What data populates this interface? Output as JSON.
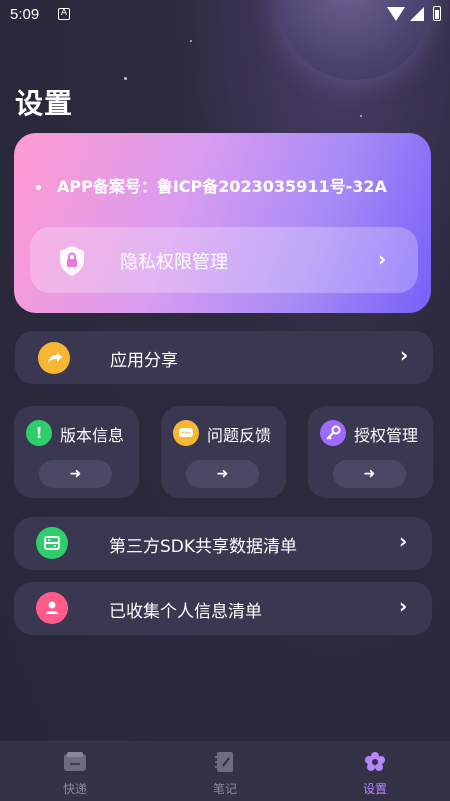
{
  "status_bar": {
    "time": "5:09",
    "notif_icon": "A"
  },
  "page_title": "设置",
  "hero": {
    "record_number": "APP备案号：鲁ICP备2023035911号-32A",
    "privacy_label": "隐私权限管理"
  },
  "rows": {
    "share": "应用分享",
    "sdk_list": "第三方SDK共享数据清单",
    "personal_info": "已收集个人信息清单"
  },
  "mini_cards": [
    {
      "label": "版本信息",
      "icon": "exclamation-icon",
      "color": "#2ecf6a"
    },
    {
      "label": "问题反馈",
      "icon": "chat-bubble-icon",
      "color": "#f7b733"
    },
    {
      "label": "授权管理",
      "icon": "key-icon",
      "color": "#9b6cff"
    }
  ],
  "tabs": [
    {
      "label": "快递",
      "icon": "wallet-icon"
    },
    {
      "label": "笔记",
      "icon": "notebook-icon"
    },
    {
      "label": "设置",
      "icon": "flower-gear-icon",
      "active": true
    }
  ],
  "colors": {
    "accent": "#b786ff",
    "share": "#f7b733",
    "sdk": "#2ecf6a",
    "personal": "#ff5c8a"
  }
}
